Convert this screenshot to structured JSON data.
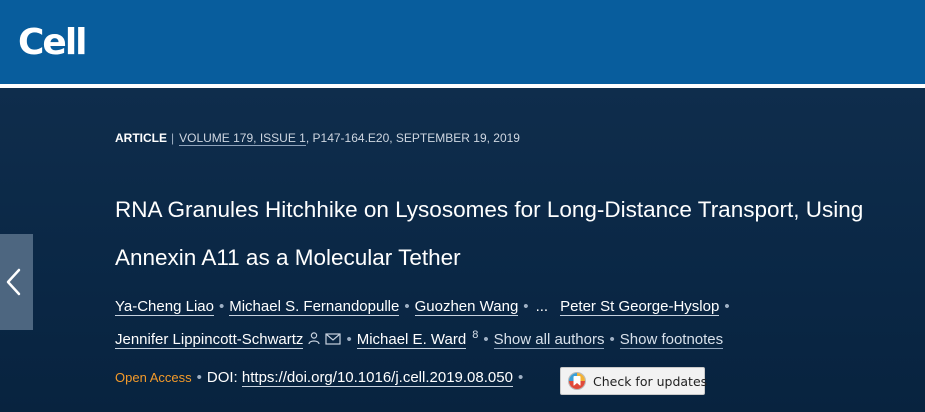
{
  "header": {
    "logo_text": "Cell"
  },
  "article": {
    "type": "ARTICLE",
    "separator": "|",
    "volume": "VOLUME 179, ISSUE 1",
    "pages_date": ", P147-164.E20, SEPTEMBER 19, 2019",
    "title": "RNA Granules Hitchhike on Lysosomes for Long-Distance Transport, Using Annexin A11 as a Molecular Tether"
  },
  "authors": {
    "list": [
      "Ya-Cheng Liao",
      "Michael S. Fernandopulle",
      "Guozhen Wang",
      "Peter St George-Hyslop",
      "Jennifer Lippincott-Schwartz",
      "Michael E. Ward"
    ],
    "ellipsis": "...",
    "footnote_marker": "8",
    "show_all": "Show all authors",
    "show_footnotes": "Show footnotes"
  },
  "access": {
    "open_access": "Open Access",
    "doi_label": "DOI:",
    "doi_url": "https://doi.org/10.1016/j.cell.2019.08.050",
    "check_updates": "Check for updates"
  },
  "icons": [
    "chevron-left-icon",
    "person-icon",
    "envelope-icon",
    "crossmark-icon"
  ],
  "colors": {
    "header": "#085d9d",
    "hero": "#0b2a4e",
    "open_access": "#f39a2a"
  }
}
